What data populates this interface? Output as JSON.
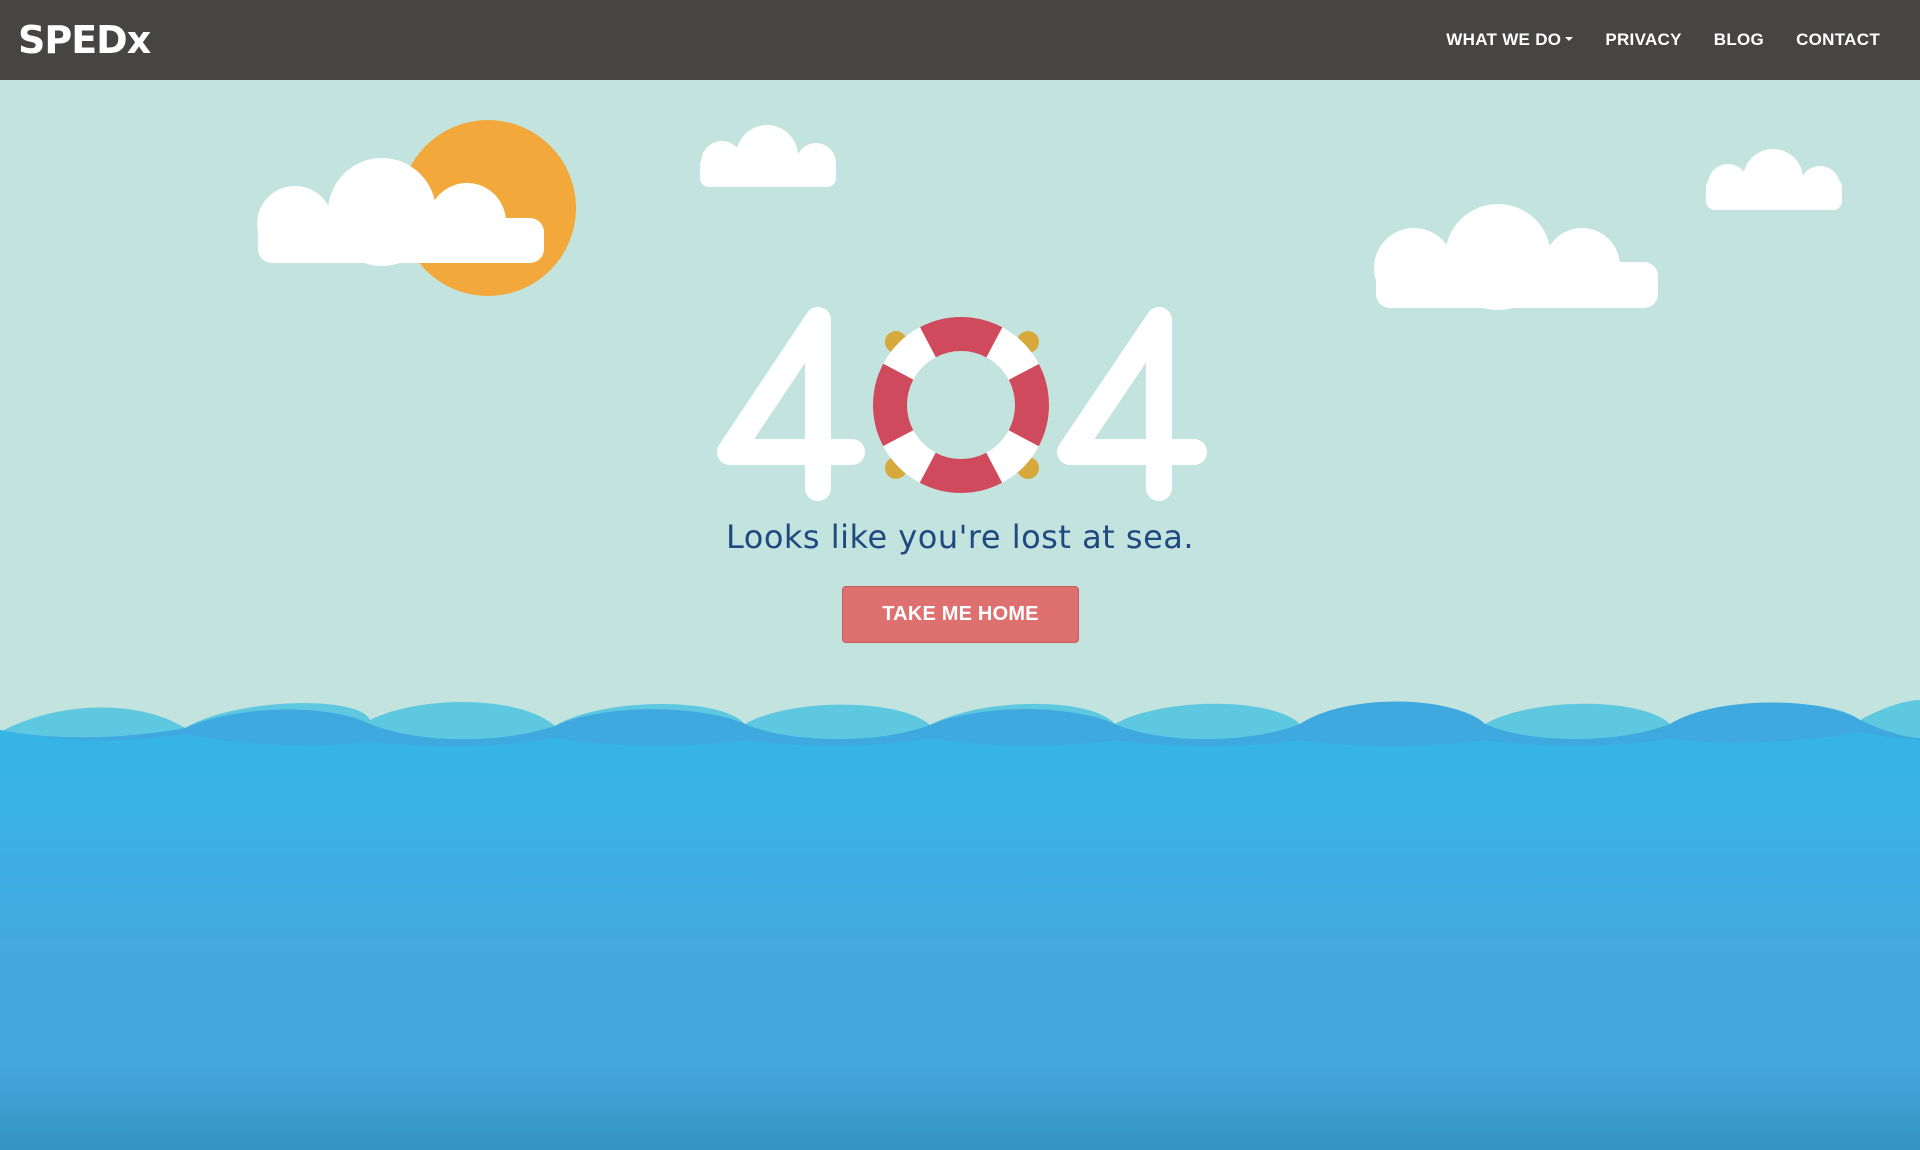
{
  "navbar": {
    "brand": "SPEDx",
    "links": [
      {
        "label": "WHAT WE DO",
        "has_dropdown": true
      },
      {
        "label": "PRIVACY",
        "has_dropdown": false
      },
      {
        "label": "BLOG",
        "has_dropdown": false
      },
      {
        "label": "CONTACT",
        "has_dropdown": false
      }
    ]
  },
  "error": {
    "code": "404",
    "message": "Looks like you're lost at sea.",
    "button_label": "TAKE ME HOME"
  },
  "illustration": {
    "icons": [
      "sun-icon",
      "cloud-icon",
      "life-ring-icon",
      "wave-icon"
    ]
  },
  "colors": {
    "navbar_bg": "#474444",
    "sky": "#c3e3de",
    "sun": "#f2a83a",
    "cloud": "#ffffff",
    "life_ring_red": "#cf4a5c",
    "life_ring_rope": "#d7a83c",
    "message_text": "#1f4a80",
    "button_bg": "#de7070",
    "sea_top": "#34b5e5",
    "sea_mid": "#45a9df",
    "sea_bottom": "#3593c3",
    "wave_light": "#5dc8e0",
    "wave_dark": "#3ea8df"
  }
}
